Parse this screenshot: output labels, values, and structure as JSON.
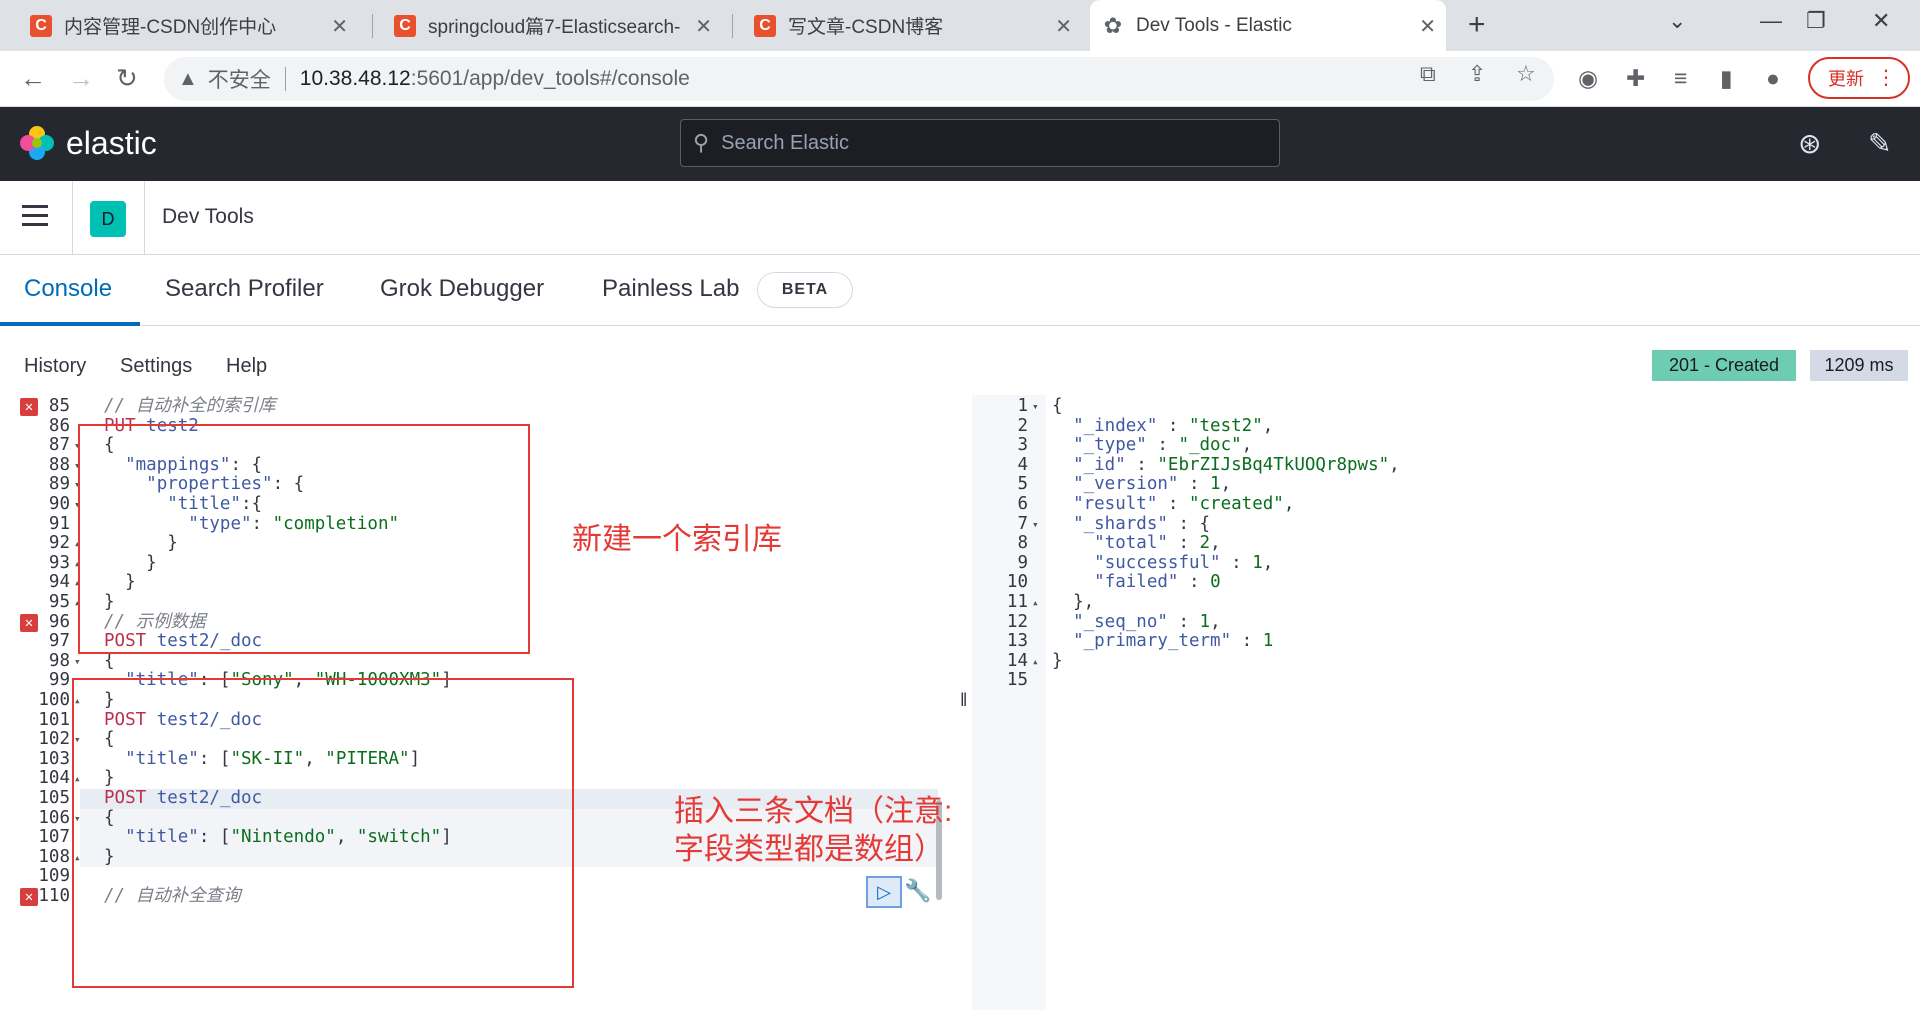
{
  "browser": {
    "tabs": [
      {
        "title": "内容管理-CSDN创作中心",
        "icon": "C"
      },
      {
        "title": "springcloud篇7-Elasticsearch-",
        "icon": "C"
      },
      {
        "title": "写文章-CSDN博客",
        "icon": "C"
      },
      {
        "title": "Dev Tools - Elastic",
        "icon": "globe"
      }
    ],
    "close_glyph": "✕",
    "security_label": "不安全",
    "url_host": "10.38.48.12",
    "url_path": ":5601/app/dev_tools#/console",
    "update_label": "更新"
  },
  "kibana": {
    "brand": "elastic",
    "search_placeholder": "Search Elastic",
    "app_badge": "D",
    "breadcrumb": "Dev Tools"
  },
  "devtools": {
    "tabs": [
      "Console",
      "Search Profiler",
      "Grok Debugger",
      "Painless Lab"
    ],
    "beta": "BETA",
    "menu": [
      "History",
      "Settings",
      "Help"
    ],
    "status": "201 - Created",
    "time": "1209 ms"
  },
  "request_lines": [
    {
      "n": "85",
      "text": "// 自动补全的索引库"
    },
    {
      "n": "86",
      "text": "PUT test2"
    },
    {
      "n": "87",
      "text": "{"
    },
    {
      "n": "88",
      "text": "  \"mappings\": {"
    },
    {
      "n": "89",
      "text": "    \"properties\": {"
    },
    {
      "n": "90",
      "text": "      \"title\":{"
    },
    {
      "n": "91",
      "text": "        \"type\": \"completion\""
    },
    {
      "n": "92",
      "text": "      }"
    },
    {
      "n": "93",
      "text": "    }"
    },
    {
      "n": "94",
      "text": "  }"
    },
    {
      "n": "95",
      "text": "}"
    },
    {
      "n": "96",
      "text": "// 示例数据"
    },
    {
      "n": "97",
      "text": "POST test2/_doc"
    },
    {
      "n": "98",
      "text": "{"
    },
    {
      "n": "99",
      "text": "  \"title\": [\"Sony\", \"WH-1000XM3\"]"
    },
    {
      "n": "100",
      "text": "}"
    },
    {
      "n": "101",
      "text": "POST test2/_doc"
    },
    {
      "n": "102",
      "text": "{"
    },
    {
      "n": "103",
      "text": "  \"title\": [\"SK-II\", \"PITERA\"]"
    },
    {
      "n": "104",
      "text": "}"
    },
    {
      "n": "105",
      "text": "POST test2/_doc"
    },
    {
      "n": "106",
      "text": "{"
    },
    {
      "n": "107",
      "text": "  \"title\": [\"Nintendo\", \"switch\"]"
    },
    {
      "n": "108",
      "text": "}"
    },
    {
      "n": "109",
      "text": ""
    },
    {
      "n": "110",
      "text": "// 自动补全查询"
    }
  ],
  "response_lines": [
    {
      "n": "1",
      "text": "{"
    },
    {
      "n": "2",
      "text": "  \"_index\" : \"test2\","
    },
    {
      "n": "3",
      "text": "  \"_type\" : \"_doc\","
    },
    {
      "n": "4",
      "text": "  \"_id\" : \"EbrZIJsBq4TkUOQr8pws\","
    },
    {
      "n": "5",
      "text": "  \"_version\" : 1,"
    },
    {
      "n": "6",
      "text": "  \"result\" : \"created\","
    },
    {
      "n": "7",
      "text": "  \"_shards\" : {"
    },
    {
      "n": "8",
      "text": "    \"total\" : 2,"
    },
    {
      "n": "9",
      "text": "    \"successful\" : 1,"
    },
    {
      "n": "10",
      "text": "    \"failed\" : 0"
    },
    {
      "n": "11",
      "text": "  },"
    },
    {
      "n": "12",
      "text": "  \"_seq_no\" : 1,"
    },
    {
      "n": "13",
      "text": "  \"_primary_term\" : 1"
    },
    {
      "n": "14",
      "text": "}"
    },
    {
      "n": "15",
      "text": ""
    }
  ],
  "annotations": {
    "index_note": "新建一个索引库",
    "docs_note_1": "插入三条文档（注意:",
    "docs_note_2": "字段类型都是数组）"
  },
  "colors": {
    "accent": "#006bb8",
    "status_green": "#6dccb1",
    "annotation_red": "#e53935",
    "header_dark": "#25282f"
  }
}
